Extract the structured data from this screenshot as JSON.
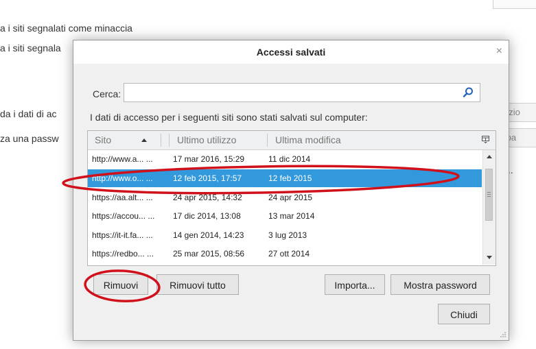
{
  "background": {
    "lines": [
      "a i siti segnalati come minaccia",
      "a i siti segnala",
      "da i dati di ac",
      "za una passw"
    ],
    "right_tabs": [
      "ccezio",
      "ncipa"
    ],
    "dots": "..."
  },
  "dialog": {
    "title": "Accessi salvati",
    "close_symbol": "×",
    "search": {
      "label": "Cerca:",
      "value": "",
      "placeholder": ""
    },
    "description": "I dati di accesso per i seguenti siti sono stati salvati sul computer:",
    "columns": [
      "Sito",
      "Ultimo utilizzo",
      "Ultima modifica"
    ],
    "sort": {
      "column": "Sito",
      "direction": "ascending"
    },
    "rows": [
      {
        "site": "http://www.a... ...",
        "last_used": "17 mar 2016, 15:29",
        "last_modified": "11 dic 2014"
      },
      {
        "site": "http://www.o... ...",
        "last_used": "12 feb 2015, 17:57",
        "last_modified": "12 feb 2015"
      },
      {
        "site": "https://aa.alt... ...",
        "last_used": "24 apr 2015, 14:32",
        "last_modified": "24 apr 2015"
      },
      {
        "site": "https://accou... ...",
        "last_used": "17 dic 2014, 13:08",
        "last_modified": "13 mar 2014"
      },
      {
        "site": "https://it-it.fa... ...",
        "last_used": "14 gen 2014, 14:23",
        "last_modified": "3 lug 2013"
      },
      {
        "site": "https://redbo... ...",
        "last_used": "25 mar 2015, 08:56",
        "last_modified": "27 ott 2014"
      }
    ],
    "selected_row": 1,
    "buttons": {
      "remove": "Rimuovi",
      "remove_all": "Rimuovi tutto",
      "import": "Importa...",
      "show_passwords": "Mostra password",
      "close": "Chiudi"
    }
  },
  "colors": {
    "selection": "#3399dd",
    "annotation": "#d0101a",
    "search_icon": "#1f63b8"
  },
  "icons": [
    "search-icon",
    "sort-ascending-icon",
    "column-picker-icon",
    "close-icon",
    "resize-grip-icon"
  ]
}
